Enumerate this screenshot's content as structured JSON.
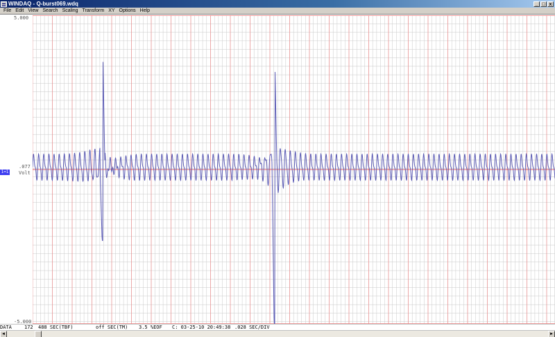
{
  "window": {
    "title": "WINDAQ - Q-burst069.wdq",
    "minimize_glyph": "_",
    "restore_glyph": "□",
    "close_glyph": "x"
  },
  "menu": [
    {
      "label": "File"
    },
    {
      "label": "Edit"
    },
    {
      "label": "View"
    },
    {
      "label": "Search"
    },
    {
      "label": "Scaling"
    },
    {
      "label": "Transform"
    },
    {
      "label": "XY"
    },
    {
      "label": "Options"
    },
    {
      "label": "Help"
    }
  ],
  "axis": {
    "top_label": "5.000",
    "bottom_label": "-5.000"
  },
  "channel": {
    "marker": "1=1",
    "value": ".077",
    "unit": "Volt"
  },
  "status": {
    "mode": "DATA",
    "samples": "172",
    "tbf": "488 SEC(TBF)",
    "tm": "off SEC(TM)",
    "eof": "3.5 %EOF",
    "timestamp": "C: 03-25-10 20:49:38",
    "div": ".028 SEC/DIV"
  },
  "scrollbar": {
    "left_glyph": "◄",
    "right_glyph": "►"
  },
  "colors": {
    "trace": "#5a5ab4",
    "grid_major": "#f08080",
    "grid_minor": "#c8c8c8",
    "zero_line": "#e03030"
  },
  "chart_data": {
    "type": "line",
    "ylim": [
      -5,
      5
    ],
    "channel_unit": "Volt",
    "sec_per_div": 0.028,
    "baseline_level": 0.077,
    "burst_events": [
      {
        "div": 3.55,
        "peak_high": 3.9,
        "peak_low": -2.3
      },
      {
        "div": 12.25,
        "peak_high": 3.6,
        "peak_low": -5.0
      }
    ]
  }
}
